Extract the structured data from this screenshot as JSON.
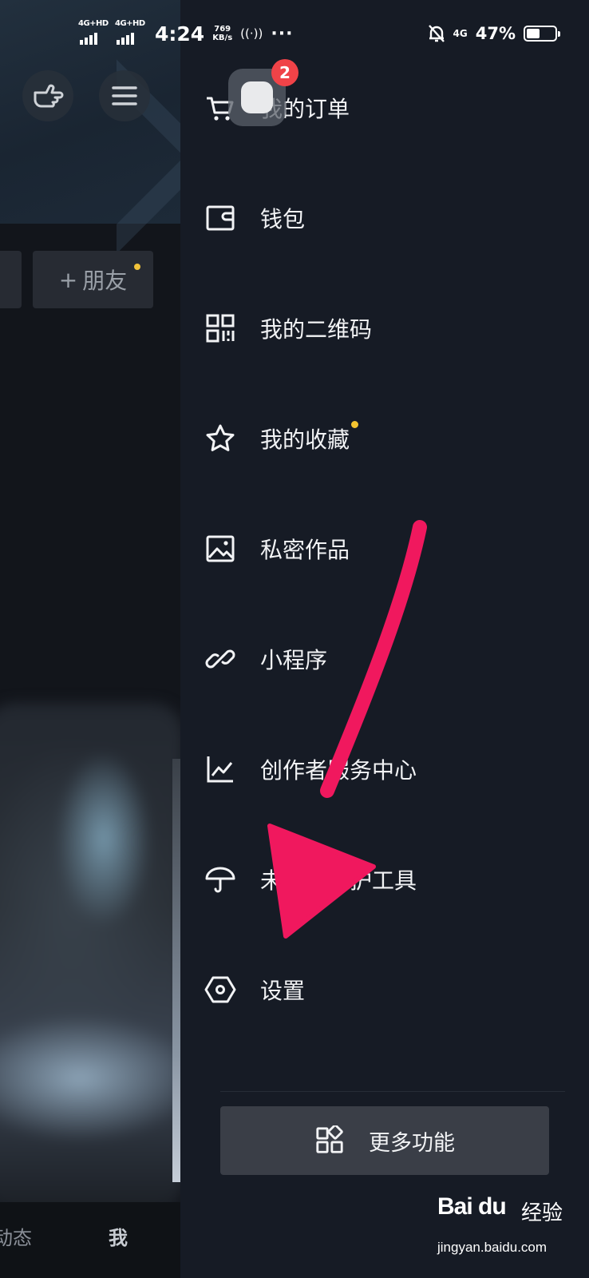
{
  "status_bar": {
    "sim1_label": "4G+HD",
    "sim2_label": "4G+HD",
    "time": "4:24",
    "speed_value": "769",
    "speed_unit": "KB/s",
    "hotspot_label": "((·))",
    "more": "···",
    "network": "4G",
    "battery_pct": "47%",
    "battery_level": 0.47
  },
  "background_page": {
    "friend_button": "朋友",
    "plus": "+",
    "tab_left": "动态",
    "tab_right": "我"
  },
  "notification": {
    "badge_count": "2"
  },
  "drawer": {
    "items": [
      {
        "label": "我的订单",
        "icon": "cart-icon"
      },
      {
        "label": "钱包",
        "icon": "wallet-icon"
      },
      {
        "label": "我的二维码",
        "icon": "qr-code-icon"
      },
      {
        "label": "我的收藏",
        "icon": "star-icon",
        "has_dot": true
      },
      {
        "label": "私密作品",
        "icon": "image-icon"
      },
      {
        "label": "小程序",
        "icon": "link-icon"
      },
      {
        "label": "创作者服务中心",
        "icon": "chart-icon"
      },
      {
        "label": "未成年保护工具",
        "icon": "umbrella-icon"
      },
      {
        "label": "设置",
        "icon": "hexagon-settings-icon"
      }
    ],
    "more_button": {
      "label": "更多功能",
      "icon": "grid-apps-icon"
    }
  },
  "colors": {
    "drawer_bg": "#161b25",
    "arrow": "#f0185e",
    "badge": "#f04348",
    "dot": "#f4c430"
  },
  "watermark": {
    "logo": "Bai du",
    "text": "经验",
    "url": "jingyan.baidu.com"
  }
}
